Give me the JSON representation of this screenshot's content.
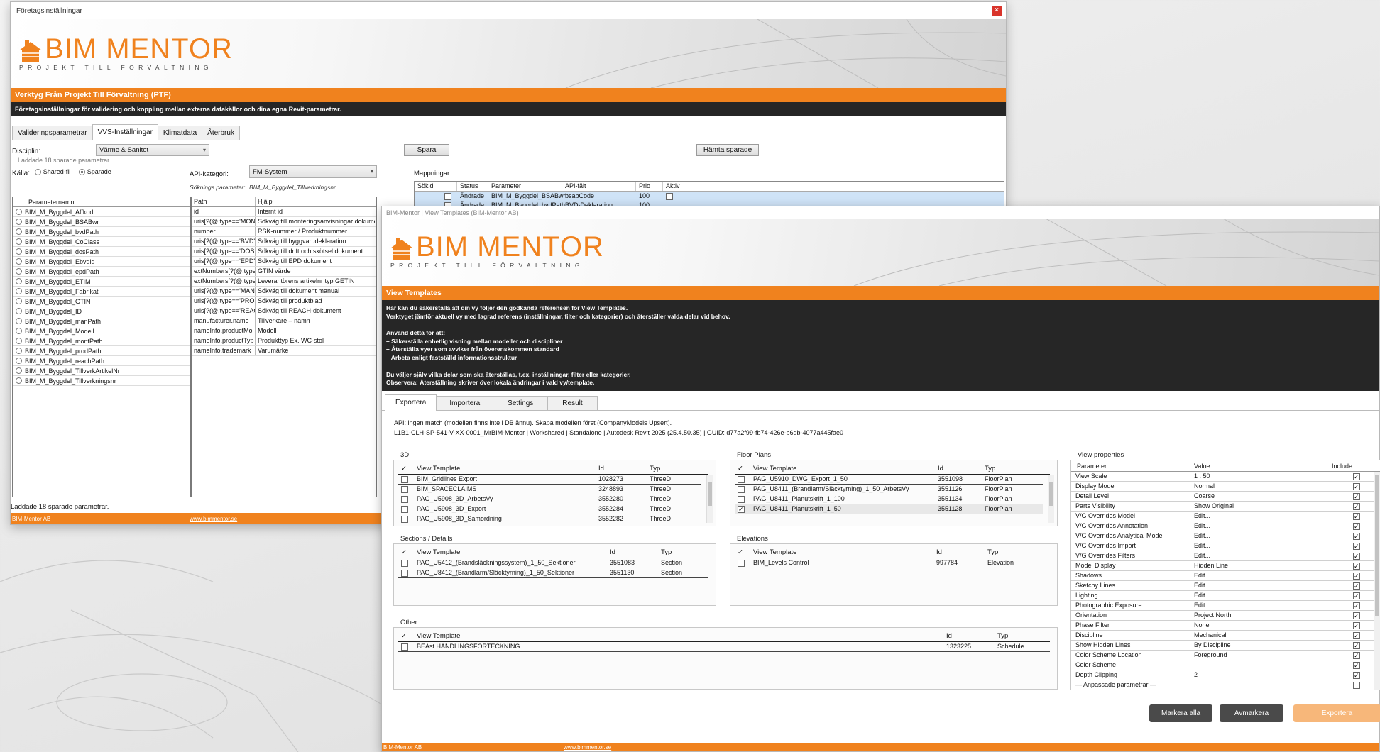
{
  "window1": {
    "title": "Företagsinställningar",
    "close": "×",
    "logo": {
      "word": "BIM MENTOR",
      "tagline": "PROJEKT TILL FÖRVALTNING"
    },
    "header": "Verktyg Från Projekt Till Förvaltning (PTF)",
    "subheader": "Företagsinställningar för validering och koppling mellan externa datakällor och dina egna Revit-parametrar.",
    "tabs": [
      "Valideringsparametrar",
      "VVS-Inställningar",
      "Klimatdata",
      "Återbruk"
    ],
    "active_tab": 1,
    "discipline_label": "Disciplin:",
    "discipline_value": "Värme & Sanitet",
    "loaded_text": "Laddade 18 sparade parametrar.",
    "source_label": "Källa:",
    "source_options": [
      "Shared-fil",
      "Sparade"
    ],
    "source_selected": "Sparade",
    "api_label": "API-kategori:",
    "api_value": "FM-System",
    "search_label": "Söknings parameter:",
    "search_value": "BIM_M_Byggdel_Tillverkningsnr",
    "save_button": "Spara",
    "fetch_button": "Hämta sparade",
    "mapping_label": "Mappningar",
    "mapping_headers": [
      "Sökld",
      "Status",
      "Parameter",
      "API-fält",
      "Prio",
      "Aktiv"
    ],
    "mapping_rows": [
      {
        "status": "Ändrade",
        "parameter": "BIM_M_Byggdel_BSABwr",
        "field": "bsabCode",
        "prio": "100"
      },
      {
        "status": "Ändrade",
        "parameter": "BIM_M_Byggdel_bvdPath",
        "field": "BVD-Deklaration",
        "prio": "100"
      }
    ],
    "param_header": "Parameternamn",
    "parameters": [
      "BIM_M_Byggdel_Affkod",
      "BIM_M_Byggdel_BSABwr",
      "BIM_M_Byggdel_bvdPath",
      "BIM_M_Byggdel_CoClass",
      "BIM_M_Byggdel_dosPath",
      "BIM_M_Byggdel_Ebvdld",
      "BIM_M_Byggdel_epdPath",
      "BIM_M_Byggdel_ETIM",
      "BIM_M_Byggdel_Fabrikat",
      "BIM_M_Byggdel_GTIN",
      "BIM_M_Byggdel_ID",
      "BIM_M_Byggdel_manPath",
      "BIM_M_Byggdel_Modell",
      "BIM_M_Byggdel_montPath",
      "BIM_M_Byggdel_prodPath",
      "BIM_M_Byggdel_reachPath",
      "BIM_M_Byggdel_TillverkArtikelNr",
      "BIM_M_Byggdel_Tillverkningsnr"
    ],
    "path_headers": [
      "Path",
      "Hjälp"
    ],
    "paths": [
      {
        "path": "id",
        "help": "Internt id"
      },
      {
        "path": "uris[?(@.type=='MON",
        "help": "Sökväg till monteringsanvisningar dokument"
      },
      {
        "path": "number",
        "help": "RSK-nummer / Produktnummer"
      },
      {
        "path": "uris[?(@.type=='BVD'",
        "help": "Sökväg till byggvarudeklaration"
      },
      {
        "path": "uris[?(@.type=='DOS",
        "help": "Sökväg till drift och skötsel dokument"
      },
      {
        "path": "uris[?(@.type=='EPD'",
        "help": "Sökväg till EPD dokument"
      },
      {
        "path": "extNumbers[?(@.type",
        "help": "GTIN värde"
      },
      {
        "path": "extNumbers[?(@.type",
        "help": "Leverantörens artikelnr typ GETIN"
      },
      {
        "path": "uris[?(@.type=='MAN",
        "help": "Sökväg till dokument manual"
      },
      {
        "path": "uris[?(@.type=='PROI",
        "help": "Sökväg till produktblad"
      },
      {
        "path": "uris[?(@.type=='REAC",
        "help": "Sökväg till REACH-dokument"
      },
      {
        "path": "manufacturer.name",
        "help": "Tillverkare – namn"
      },
      {
        "path": "nameInfo.productMo",
        "help": "Modell"
      },
      {
        "path": "nameInfo.productTyp",
        "help": "Produkttyp Ex. WC-stol"
      },
      {
        "path": "nameInfo.trademark",
        "help": "Varumärke"
      }
    ],
    "status": "Laddade 18 sparade parametrar.",
    "footer_company": "BIM-Mentor AB",
    "footer_link": "www.bimmentor.se"
  },
  "window2": {
    "title": "BIM-Mentor | View Templates (BIM-Mentor AB)",
    "header": "View Templates",
    "info_lines": [
      "Här kan du säkerställa att din vy följer den godkända referensen för View Templates.",
      "Verktyget jämför aktuell vy med lagrad referens (inställningar, filter och kategorier) och återställer valda delar vid behov.",
      "",
      "Använd detta för att:",
      "– Säkerställa enhetlig visning mellan modeller och discipliner",
      "– Återställa vyer som avviker från överenskommen standard",
      "– Arbeta enligt fastställd informationsstruktur",
      "",
      "Du väljer själv vilka delar som ska återställas, t.ex. inställningar, filter eller kategorier.",
      "Observera: Återställning skriver över lokala ändringar i vald vy/template."
    ],
    "tabs": [
      "Exportera",
      "Importera",
      "Settings",
      "Result"
    ],
    "active_tab": 0,
    "api_line": "API: ingen match (modellen finns inte i DB ännu). Skapa modellen först (CompanyModels Upsert).",
    "model_line": "L1B1-CLH-SP-541-V-XX-0001_MrBIM-Mentor  |  Workshared  |  Standalone  |  Autodesk Revit 2025 (25.4.50.35)  |  GUID: d77a2f99-fb74-426e-b6db-4077a445fae0",
    "col_headers": {
      "check": "✓",
      "name": "View Template",
      "id": "Id",
      "type": "Typ"
    },
    "sections": {
      "3d": {
        "label": "3D",
        "rows": [
          {
            "name": "BIM_Gridlines Export",
            "id": "1028273",
            "type": "ThreeD",
            "checked": false
          },
          {
            "name": "BIM_SPACECLAIMS",
            "id": "3248893",
            "type": "ThreeD",
            "checked": false
          },
          {
            "name": "PAG_U5908_3D_ArbetsVy",
            "id": "3552280",
            "type": "ThreeD",
            "checked": false
          },
          {
            "name": "PAG_U5908_3D_Export",
            "id": "3552284",
            "type": "ThreeD",
            "checked": false
          },
          {
            "name": "PAG_U5908_3D_Samordning",
            "id": "3552282",
            "type": "ThreeD",
            "checked": false
          }
        ]
      },
      "floor": {
        "label": "Floor Plans",
        "rows": [
          {
            "name": "PAG_U5910_DWG_Export_1_50",
            "id": "3551098",
            "type": "FloorPlan",
            "checked": false
          },
          {
            "name": "PAG_U8411_(Brandlarm/Släcktyrning)_1_50_ArbetsVy",
            "id": "3551126",
            "type": "FloorPlan",
            "checked": false
          },
          {
            "name": "PAG_U8411_Planutskrift_1_100",
            "id": "3551134",
            "type": "FloorPlan",
            "checked": false
          },
          {
            "name": "PAG_U8411_Planutskrift_1_50",
            "id": "3551128",
            "type": "FloorPlan",
            "checked": true
          }
        ]
      },
      "sections": {
        "label": "Sections / Details",
        "rows": [
          {
            "name": "PAG_U5412_(Brandsläckningssystem)_1_50_Sektioner",
            "id": "3551083",
            "type": "Section",
            "checked": false
          },
          {
            "name": "PAG_U8412_(Brandlarm/Släcktyrning)_1_50_Sektioner",
            "id": "3551130",
            "type": "Section",
            "checked": false
          }
        ]
      },
      "elevations": {
        "label": "Elevations",
        "rows": [
          {
            "name": "BIM_Levels Control",
            "id": "997784",
            "type": "Elevation",
            "checked": false
          }
        ]
      },
      "other": {
        "label": "Other",
        "rows": [
          {
            "name": "BEAst HANDLINGSFÖRTECKNING",
            "id": "1323225",
            "type": "Schedule",
            "checked": false
          }
        ]
      }
    },
    "vp": {
      "label": "View properties",
      "headers": [
        "Parameter",
        "Value",
        "Include"
      ],
      "rows": [
        {
          "p": "View Scale",
          "v": "1 : 50",
          "inc": true
        },
        {
          "p": "Display Model",
          "v": "Normal",
          "inc": true
        },
        {
          "p": "Detail Level",
          "v": "Coarse",
          "inc": true
        },
        {
          "p": "Parts Visibility",
          "v": "Show Original",
          "inc": true
        },
        {
          "p": "V/G Overrides Model",
          "v": "Edit...",
          "inc": true
        },
        {
          "p": "V/G Overrides Annotation",
          "v": "Edit...",
          "inc": true
        },
        {
          "p": "V/G Overrides Analytical Model",
          "v": "Edit...",
          "inc": true
        },
        {
          "p": "V/G Overrides Import",
          "v": "Edit...",
          "inc": true
        },
        {
          "p": "V/G Overrides Filters",
          "v": "Edit...",
          "inc": true
        },
        {
          "p": "Model Display",
          "v": "Hidden Line",
          "inc": true
        },
        {
          "p": "Shadows",
          "v": "Edit...",
          "inc": true
        },
        {
          "p": "Sketchy Lines",
          "v": "Edit...",
          "inc": true
        },
        {
          "p": "Lighting",
          "v": "Edit...",
          "inc": true
        },
        {
          "p": "Photographic Exposure",
          "v": "Edit...",
          "inc": true
        },
        {
          "p": "Orientation",
          "v": "Project North",
          "inc": true
        },
        {
          "p": "Phase Filter",
          "v": "None",
          "inc": true
        },
        {
          "p": "Discipline",
          "v": "Mechanical",
          "inc": true
        },
        {
          "p": "Show Hidden Lines",
          "v": "By Discipline",
          "inc": true
        },
        {
          "p": "Color Scheme Location",
          "v": "Foreground",
          "inc": true
        },
        {
          "p": "Color Scheme",
          "v": "",
          "inc": true
        },
        {
          "p": "Depth Clipping",
          "v": "2",
          "inc": true
        },
        {
          "p": "— Anpassade parametrar —",
          "v": "",
          "inc": false
        }
      ]
    },
    "buttons": {
      "mark_all": "Markera alla",
      "unmark": "Avmarkera",
      "export": "Exportera"
    },
    "footer_company": "BIM-Mentor AB",
    "footer_link": "www.bimmentor.se"
  }
}
